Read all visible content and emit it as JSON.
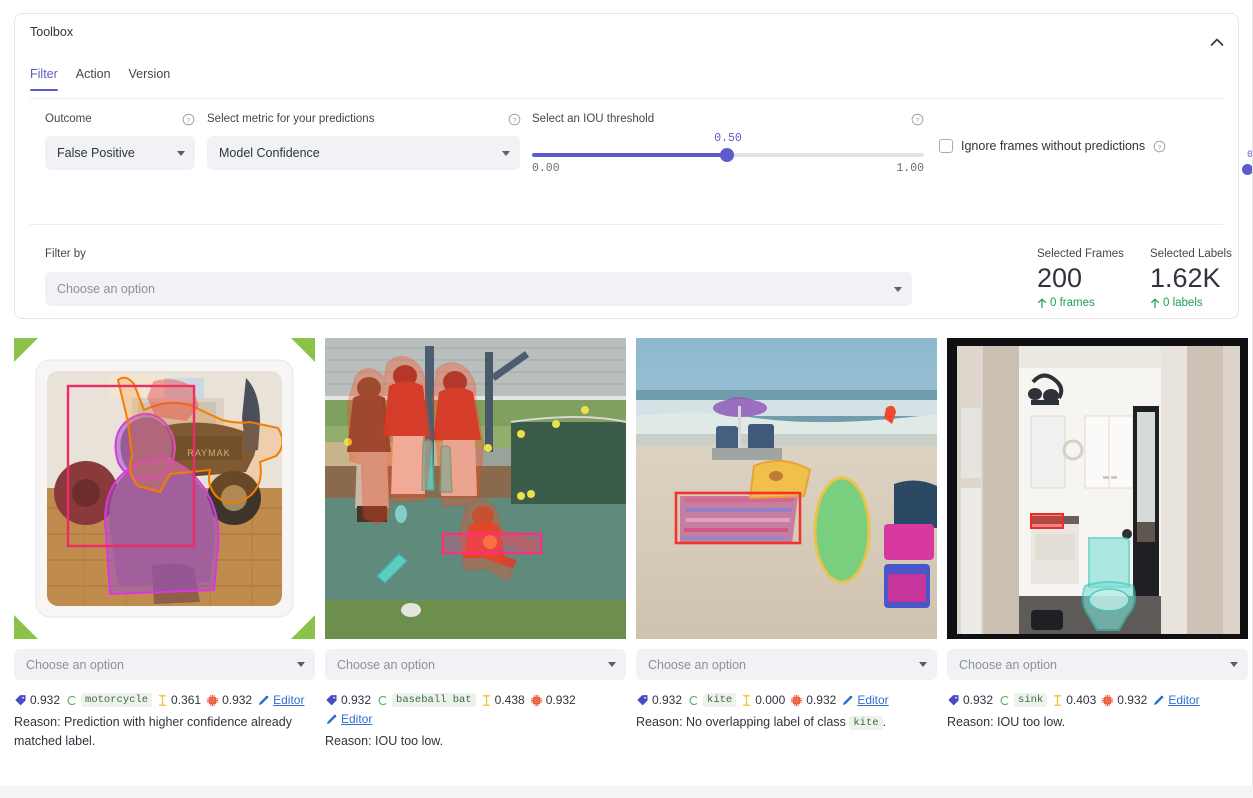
{
  "toolbox": {
    "title": "Toolbox",
    "collapse_icon": "chevron-up-icon",
    "tabs": [
      {
        "label": "Filter",
        "active": true
      },
      {
        "label": "Action",
        "active": false
      },
      {
        "label": "Version",
        "active": false
      }
    ],
    "fields": {
      "outcome": {
        "label": "Outcome",
        "value": "False Positive",
        "help_icon": "question-circle-icon"
      },
      "metric": {
        "label": "Select metric for your predictions",
        "value": "Model Confidence",
        "help_icon": "question-circle-icon"
      },
      "iou": {
        "label": "Select an IOU threshold",
        "help_icon": "question-circle-icon",
        "value": "0.50",
        "min": "0.00",
        "max": "1.00",
        "percent": 50
      },
      "ignore_frames": {
        "label": "Ignore frames without predictions",
        "checked": false,
        "help_icon": "question-circle-icon"
      },
      "filter_by": {
        "label": "Filter by",
        "placeholder": "Choose an option"
      }
    },
    "stats": [
      {
        "label": "Selected Frames",
        "value": "200",
        "delta": "0 frames",
        "delta_icon": "arrow-up-icon",
        "delta_color": "#1f9d55"
      },
      {
        "label": "Selected Labels",
        "value": "1.62K",
        "delta": "0 labels",
        "delta_icon": "arrow-up-icon",
        "delta_color": "#1f9d55"
      }
    ]
  },
  "colors": {
    "accent": "#5c5ccc",
    "success": "#1f9d55",
    "link": "#2f6fd0",
    "field_bg": "#f0f2f6",
    "selection_corner": "#8bc34a"
  },
  "cards": [
    {
      "scene": "dog-and-motorcycle-indoors",
      "selected": true,
      "select_placeholder": "Choose an option",
      "confidence_icon": "tag-icon",
      "confidence": "0.932",
      "class_icon": "class-letter-c-icon",
      "class_name": "motorcycle",
      "iou_icon": "i-beam-icon",
      "iou": "0.361",
      "model_conf_icon": "chip-icon",
      "model_confidence": "0.932",
      "editor_icon": "pencil-icon",
      "editor_label": "Editor",
      "reason": "Reason: Prediction with higher confidence already matched label."
    },
    {
      "scene": "baseball-practice-field",
      "selected": false,
      "select_placeholder": "Choose an option",
      "confidence_icon": "tag-icon",
      "confidence": "0.932",
      "class_icon": "class-letter-c-icon",
      "class_name": "baseball bat",
      "iou_icon": "i-beam-icon",
      "iou": "0.438",
      "model_conf_icon": "chip-icon",
      "model_confidence": "0.932",
      "editor_icon": "pencil-icon",
      "editor_label": "Editor",
      "reason": "Reason: IOU too low."
    },
    {
      "scene": "beach-with-umbrella-and-surfboard",
      "selected": false,
      "select_placeholder": "Choose an option",
      "confidence_icon": "tag-icon",
      "confidence": "0.932",
      "class_icon": "class-letter-c-icon",
      "class_name": "kite",
      "iou_icon": "i-beam-icon",
      "iou": "0.000",
      "model_conf_icon": "chip-icon",
      "model_confidence": "0.932",
      "editor_icon": "pencil-icon",
      "editor_label": "Editor",
      "reason_prefix": "Reason: No overlapping label of class",
      "reason_chip": "kite",
      "reason_suffix": "."
    },
    {
      "scene": "bathroom-with-toilet",
      "selected": false,
      "select_placeholder": "Choose an option",
      "confidence_icon": "tag-icon",
      "confidence": "0.932",
      "class_icon": "class-letter-c-icon",
      "class_name": "sink",
      "iou_icon": "i-beam-icon",
      "iou": "0.403",
      "model_conf_icon": "chip-icon",
      "model_confidence": "0.932",
      "editor_icon": "pencil-icon",
      "editor_label": "Editor",
      "reason": "Reason: IOU too low."
    }
  ],
  "edge": {
    "value": "0"
  }
}
